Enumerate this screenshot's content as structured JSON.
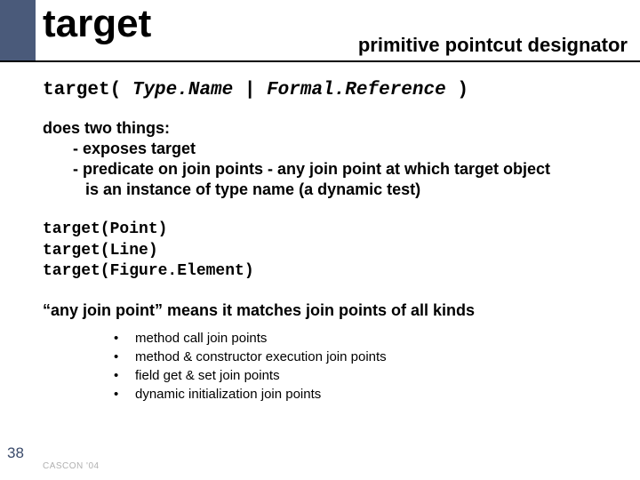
{
  "title": "target",
  "subtitle": "primitive pointcut designator",
  "syntax": {
    "keyword": "target",
    "open": "(",
    "arg1": "Type.Name",
    "sep": " | ",
    "arg2": "Formal.Reference",
    "close": ")"
  },
  "does": {
    "heading": "does two things:",
    "line1": "- exposes target",
    "line2a": "- predicate on join points - any join point at which target object",
    "line2b": "is an instance of type name (a dynamic test)"
  },
  "examples": [
    "target(Point)",
    "target(Line)",
    "target(Figure.Element)"
  ],
  "anykind": "“any join point” means it matches join points of all kinds",
  "bullets": [
    "method call join points",
    "method & constructor execution join points",
    "field get & set join points",
    "dynamic initialization join points"
  ],
  "slide_number": "38",
  "footer": "CASCON '04"
}
